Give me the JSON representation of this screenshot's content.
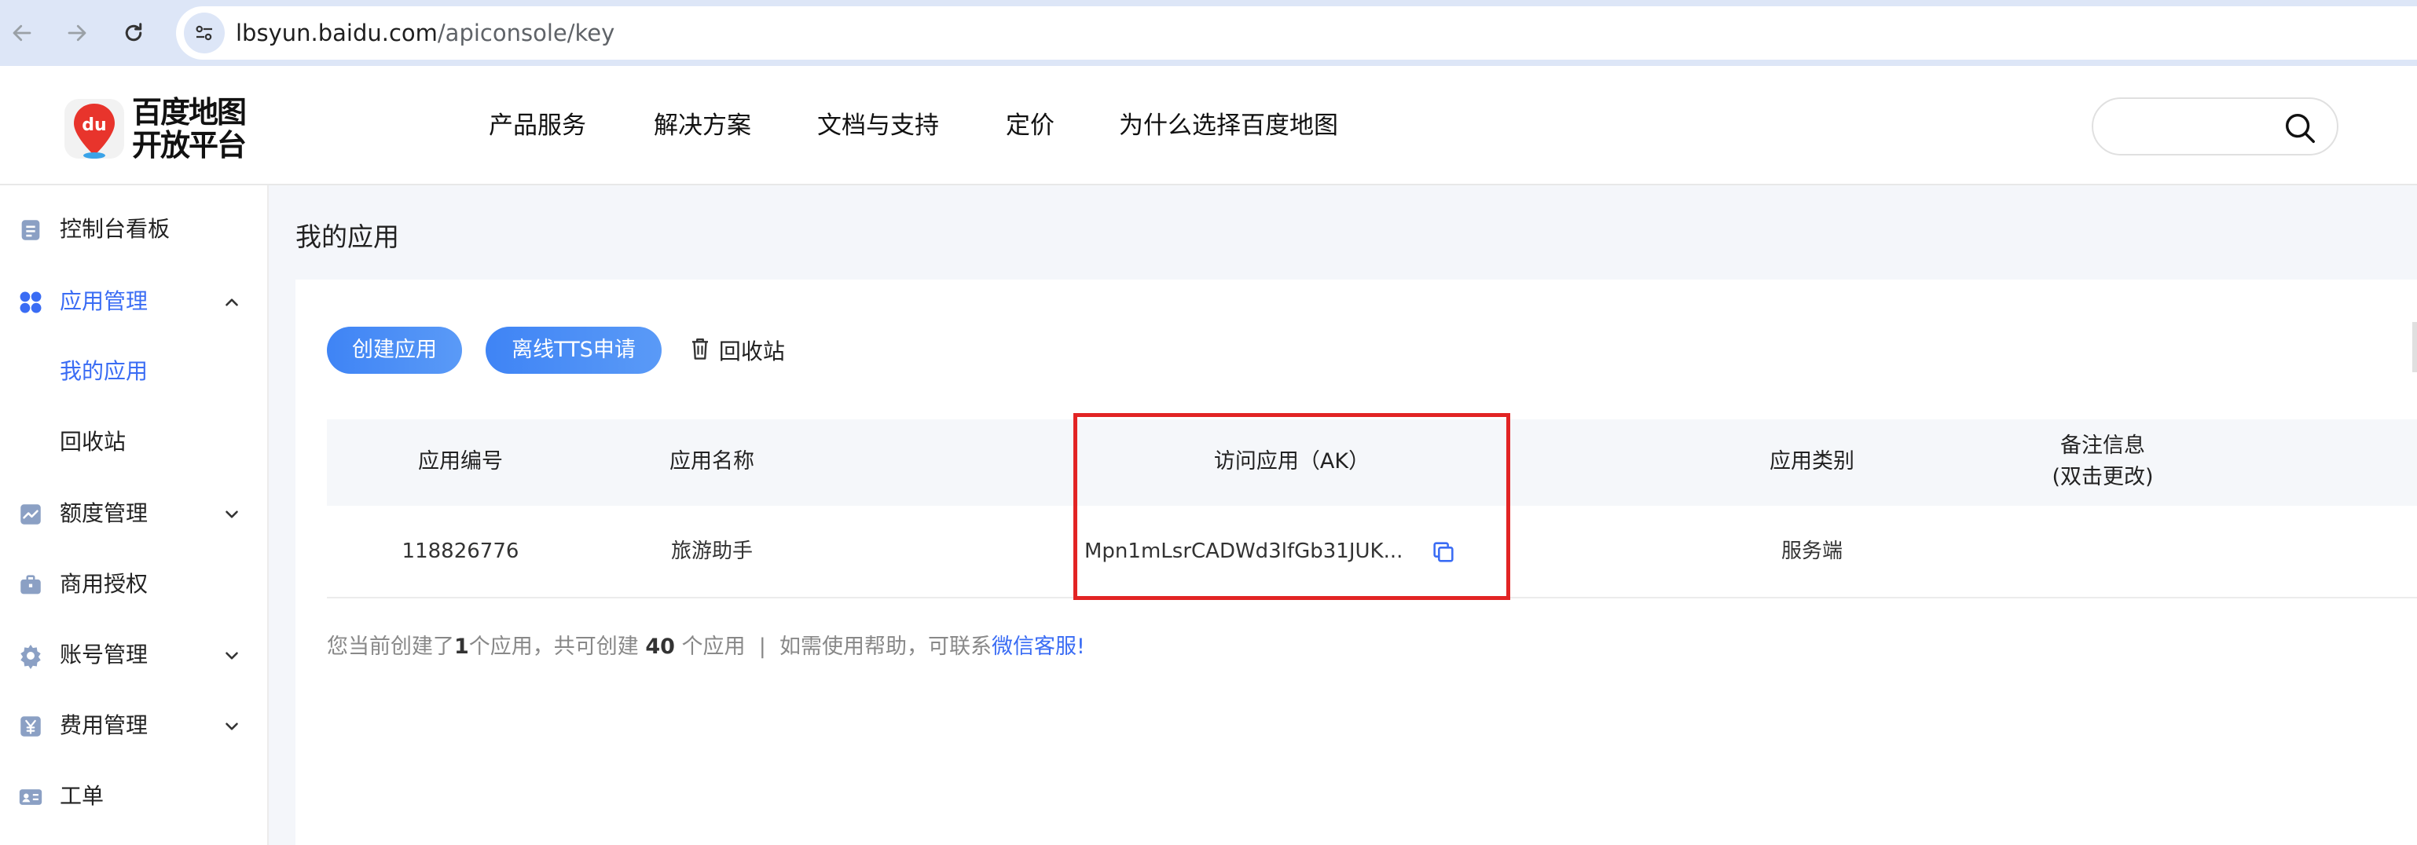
{
  "browser": {
    "url_domain": "lbsyun.baidu.com",
    "url_path": "/apiconsole/key"
  },
  "header": {
    "logo_line1": "百度地图",
    "logo_line2": "开放平台",
    "logo_badge": "du",
    "nav": [
      "产品服务",
      "解决方案",
      "文档与支持",
      "定价",
      "为什么选择百度地图"
    ],
    "search_placeholder": ""
  },
  "sidebar": {
    "items": [
      {
        "label": "控制台看板",
        "icon": "document-icon"
      },
      {
        "label": "应用管理",
        "icon": "apps-icon",
        "active": true,
        "expanded": true
      },
      {
        "label": "额度管理",
        "icon": "chart-icon"
      },
      {
        "label": "商用授权",
        "icon": "briefcase-icon"
      },
      {
        "label": "账号管理",
        "icon": "gear-icon"
      },
      {
        "label": "费用管理",
        "icon": "yen-icon"
      },
      {
        "label": "工单",
        "icon": "id-card-icon"
      }
    ],
    "subitems": [
      {
        "label": "我的应用",
        "active": true
      },
      {
        "label": "回收站"
      }
    ]
  },
  "main": {
    "page_title": "我的应用",
    "create_button": "创建应用",
    "tts_button": "离线TTS申请",
    "recycle_label": "回收站",
    "table": {
      "columns": [
        "应用编号",
        "应用名称",
        "访问应用（AK）",
        "应用类别",
        "备注信息",
        "(双击更改)"
      ],
      "rows": [
        {
          "id": "118826776",
          "name": "旅游助手",
          "ak": "Mpn1mLsrCADWd3lfGb31JUK...",
          "category": "服务端",
          "remark": ""
        }
      ]
    },
    "footer": {
      "prefix": "您当前创建了",
      "created_count": "1",
      "mid": "个应用，共可创建 ",
      "max_count": "40",
      "suffix": " 个应用  |  如需使用帮助，可联系",
      "link": "微信客服!"
    }
  },
  "colors": {
    "accent": "#3a6cf4",
    "highlight": "#e22424",
    "browser_chrome": "#dde6f7"
  }
}
